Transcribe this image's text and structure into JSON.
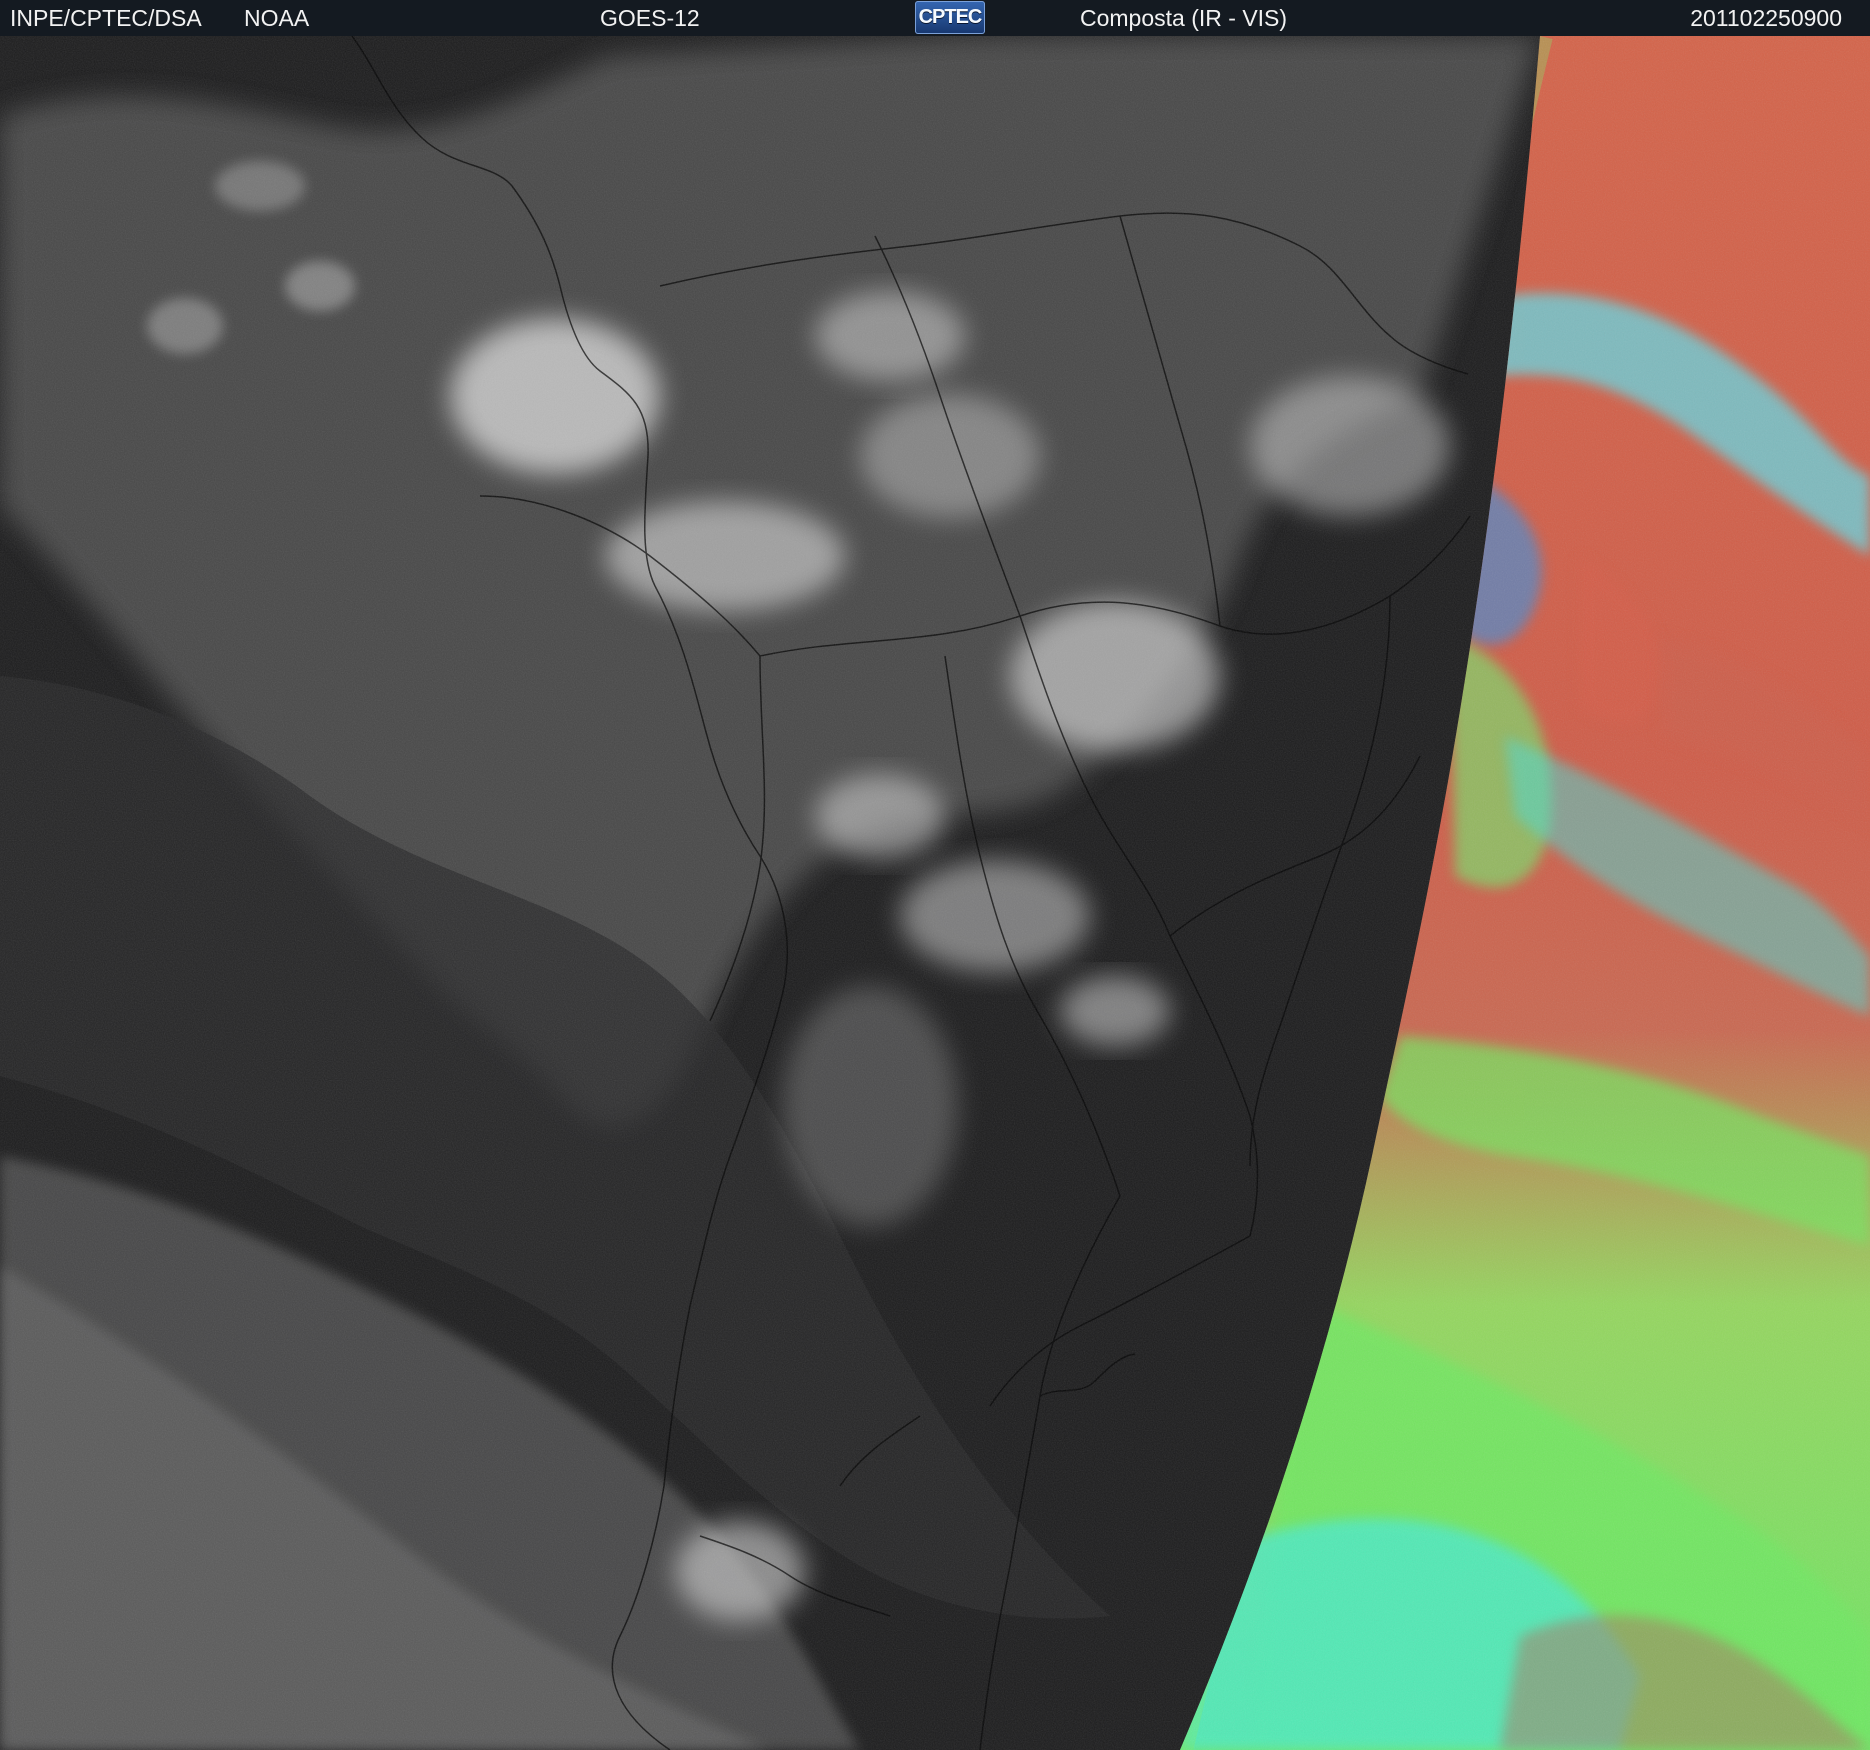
{
  "header": {
    "left_org": "INPE/CPTEC/DSA",
    "agency": "NOAA",
    "satellite": "GOES-12",
    "logo_text": "CPTEC",
    "product": "Composta (IR - VIS)",
    "timestamp": "201102250900"
  },
  "image": {
    "subject": "GOES-12 composite satellite image of South America",
    "night_color_left": "#202021",
    "color_enhanced_day_side": [
      "#d96249",
      "#69ea63",
      "#3eeccd",
      "#a95a61"
    ]
  }
}
